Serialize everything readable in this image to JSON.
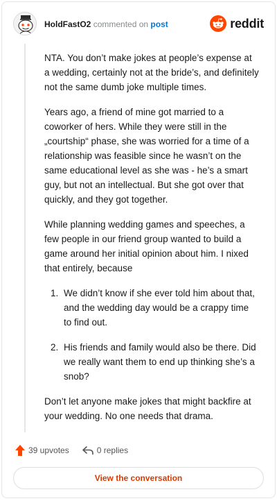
{
  "header": {
    "username": "HoldFastO2",
    "commented_text": "commented on",
    "post_link": "post",
    "brand": "reddit",
    "brand_color": "#ff4500"
  },
  "comment": {
    "paragraphs": [
      "NTA. You don’t make jokes at people’s expense at a wedding, certainly not at the bride’s, and definitely not the same dumb joke multiple times.",
      "Years ago, a friend of mine got married to a coworker of hers. While they were still in the „courtship“ phase, she was worried for a time of a relationship was feasible since he wasn’t on the same educational level as she was - he’s a smart guy, but not an intellectual. But she got over that quickly, and they got together.",
      "While planning wedding games and speeches, a few people in our friend group wanted to build a game around her initial opinion about him. I nixed that entirely, because"
    ],
    "list": [
      "We didn’t know if she ever told him about that, and the wedding day would be a crappy time to find out.",
      "His friends and family would also be there. Did we really want them to end up thinking she’s a snob?"
    ],
    "closing": "Don’t let anyone make jokes that might backfire at your wedding. No one needs that drama."
  },
  "actions": {
    "upvotes": "39 upvotes",
    "replies": "0 replies",
    "upvote_color": "#ff4500",
    "icons": [
      "upvote-arrow-icon",
      "reply-arrow-icon"
    ]
  },
  "cta": {
    "label": "View the conversation",
    "color": "#d93a00"
  }
}
